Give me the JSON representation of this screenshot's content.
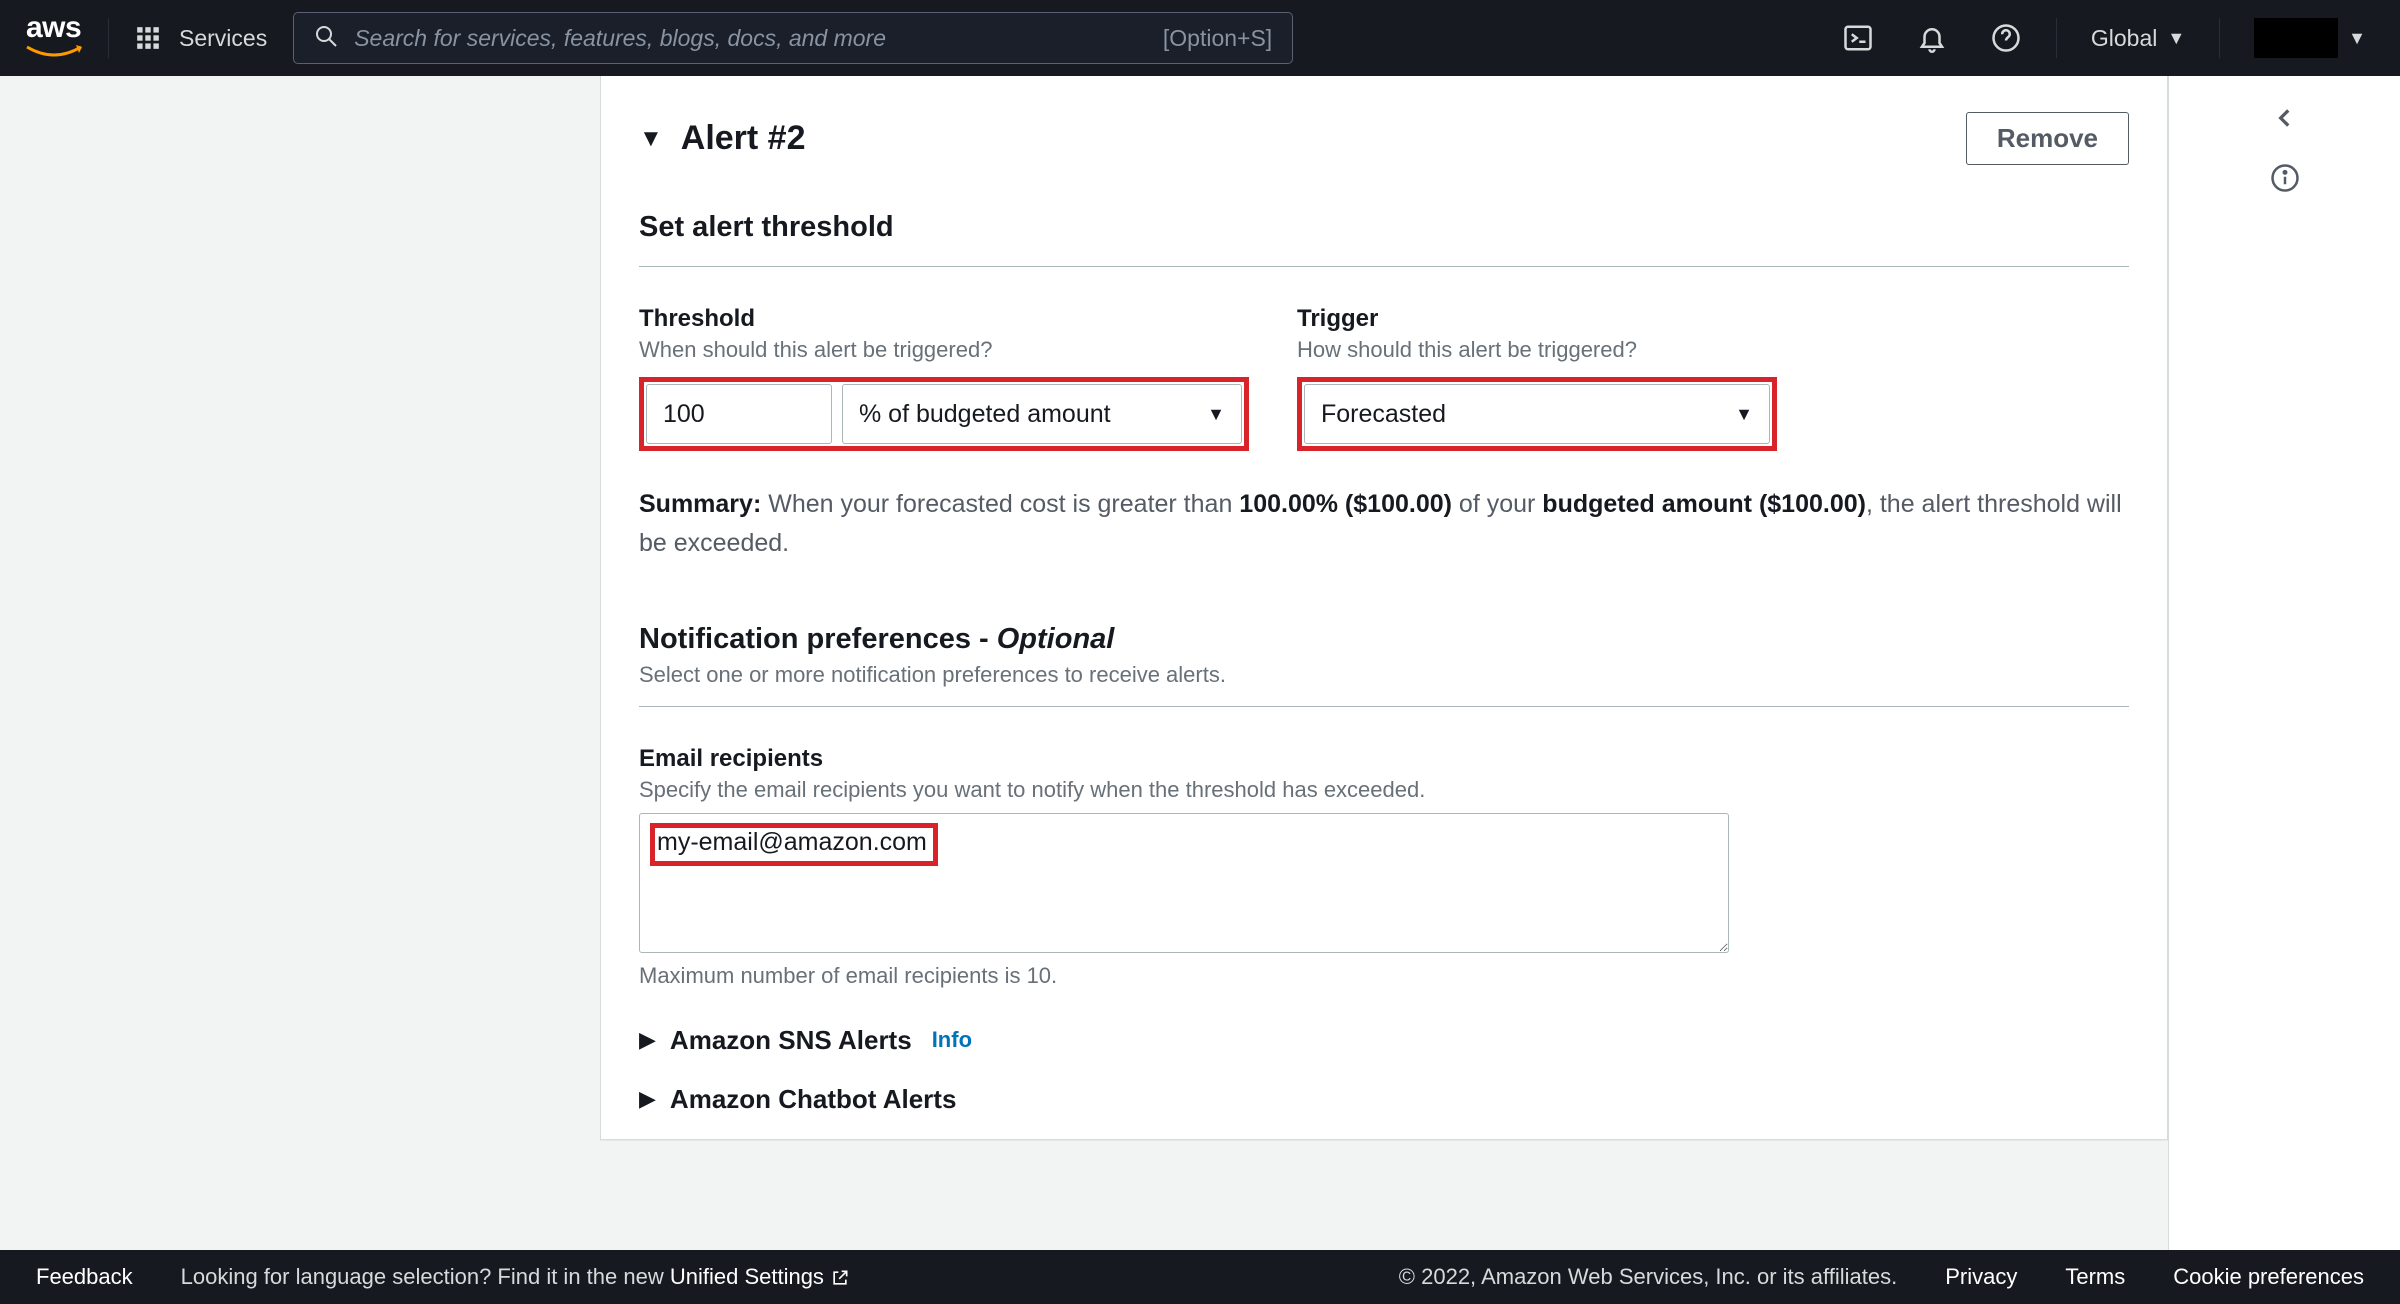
{
  "nav": {
    "services": "Services",
    "search_placeholder": "Search for services, features, blogs, docs, and more",
    "shortcut": "[Option+S]",
    "region": "Global"
  },
  "card": {
    "title": "Alert #2",
    "remove": "Remove",
    "set_threshold": "Set alert threshold",
    "threshold": {
      "label": "Threshold",
      "hint": "When should this alert be triggered?",
      "value": "100",
      "unit_select": "% of budgeted amount"
    },
    "trigger": {
      "label": "Trigger",
      "hint": "How should this alert be triggered?",
      "select": "Forecasted"
    },
    "summary": {
      "lead": "Summary:",
      "p1": "When your forecasted cost is greater than ",
      "pct": "100.00% ($100.00)",
      "p2": " of your ",
      "budgeted": "budgeted amount ($100.00)",
      "p3": ", the alert threshold will be exceeded."
    },
    "notif": {
      "title": "Notification preferences - ",
      "optional": "Optional",
      "hint": "Select one or more notification preferences to receive alerts."
    },
    "email": {
      "label": "Email recipients",
      "hint": "Specify the email recipients you want to notify when the threshold has exceeded.",
      "value": "my-email@amazon.com",
      "max_hint": "Maximum number of email recipients is 10."
    },
    "sns": {
      "label": "Amazon SNS Alerts",
      "info": "Info"
    },
    "chatbot": {
      "label": "Amazon Chatbot Alerts"
    }
  },
  "footer": {
    "feedback": "Feedback",
    "lang_q": "Looking for language selection? Find it in the new ",
    "unified": "Unified Settings",
    "copyright": "© 2022, Amazon Web Services, Inc. or its affiliates.",
    "privacy": "Privacy",
    "terms": "Terms",
    "cookie": "Cookie preferences"
  }
}
